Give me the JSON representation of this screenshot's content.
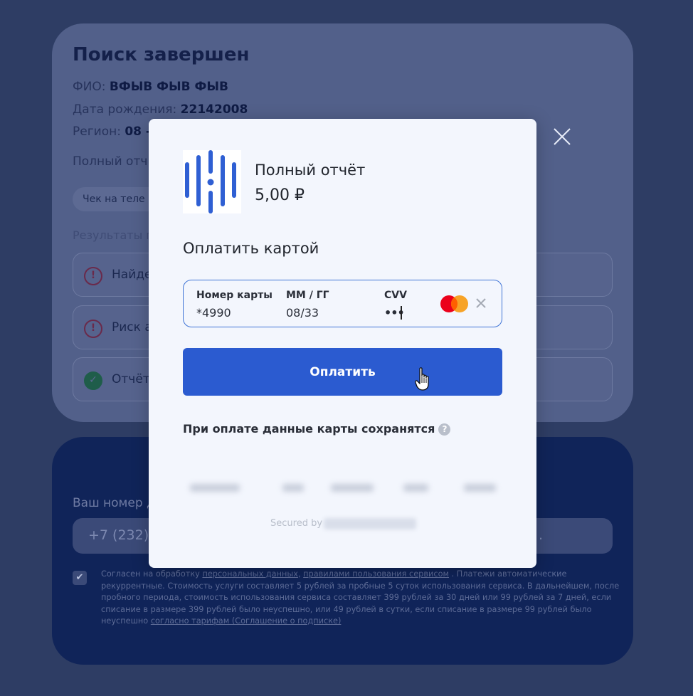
{
  "background": {
    "title": "Поиск завершен",
    "fio_label": "ФИО:",
    "fio_value": "ВФЫВ ФЫВ ФЫВ",
    "dob_label": "Дата рождения:",
    "dob_value": "22142008",
    "region_label": "Регион:",
    "region_value": "08 -",
    "report_label": "Полный отч",
    "pill_label": "Чек на теле",
    "results_label": "Результаты п",
    "results": [
      {
        "icon": "!",
        "text": "Найде"
      },
      {
        "icon": "!",
        "text": "Риск а"
      },
      {
        "icon": "✓",
        "text": "Отчёт"
      }
    ],
    "phone_label": "Ваш номер д",
    "phone_value": "+7 (232)",
    "phone_tail": ".",
    "terms": {
      "t1": "Согласен на обработку",
      "link1": "персональных данных",
      "t2": ",",
      "link2": "правилами пользования сервисом",
      "t3": ". Платежи автоматические рекуррентные. Стоимость услуги составляет 5 рублей за пробные 5 суток использования сервиса. В дальнейшем, после пробного периода, стоимость использования сервиса составляет 399 рублей за 30 дней или 99 рублей за 7 дней, если списание в размере 399 рублей было неуспешно, или 49 рублей в сутки, если списание в размере 99 рублей было неуспешно",
      "link3": "согласно тарифам (Соглашение о подписке)"
    }
  },
  "modal": {
    "product_name": "Полный отчёт",
    "price": "5,00 ₽",
    "pay_title": "Оплатить картой",
    "card": {
      "number_label": "Номер карты",
      "number_value": "*4990",
      "expiry_label": "ММ / ГГ",
      "expiry_value": "08/33",
      "cvv_label": "CVV",
      "cvv_value": "•••"
    },
    "pay_button": "Оплатить",
    "save_note": "При оплате данные карты сохранятся",
    "secured_by": "Secured by"
  },
  "colors": {
    "accent": "#2b5bd0",
    "overlay": "#2e3d64",
    "mastercard_red": "#eb001b",
    "mastercard_orange": "#f79e1b"
  },
  "icons": {
    "close": "close-icon",
    "clear": "clear-icon",
    "help": "question-icon",
    "card_brand": "mastercard-icon",
    "cursor": "hand-cursor-icon"
  }
}
